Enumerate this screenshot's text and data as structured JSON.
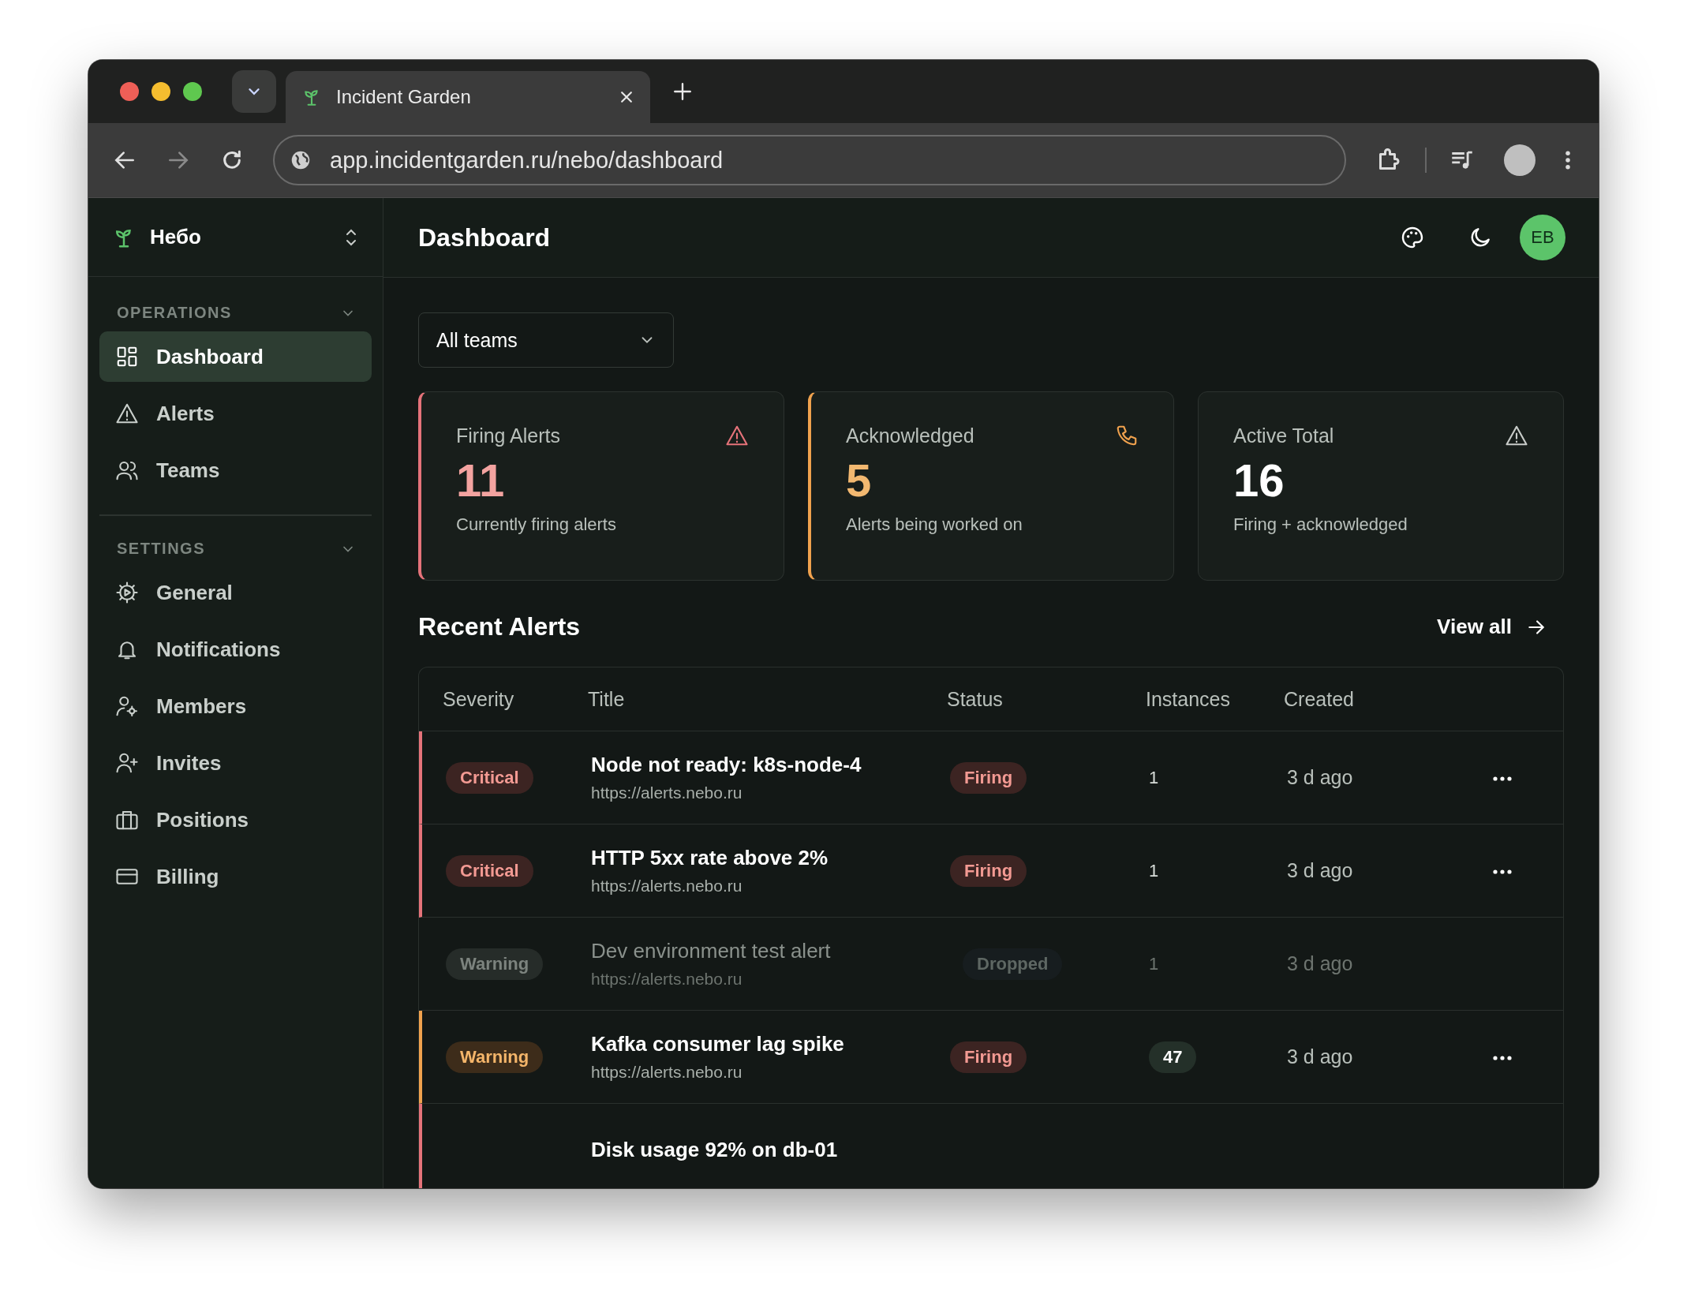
{
  "browser": {
    "tab_title": "Incident Garden",
    "url": "app.incidentgarden.ru/nebo/dashboard"
  },
  "sidebar": {
    "org": "Небо",
    "sections": [
      {
        "title": "OPERATIONS",
        "expanded": true,
        "items": [
          {
            "label": "Dashboard",
            "kind": "grid",
            "selected": true
          },
          {
            "label": "Alerts",
            "kind": "warning",
            "selected": false
          },
          {
            "label": "Teams",
            "kind": "users",
            "selected": false
          }
        ]
      },
      {
        "title": "SETTINGS",
        "expanded": true,
        "items": [
          {
            "label": "General",
            "kind": "gear",
            "selected": false
          },
          {
            "label": "Notifications",
            "kind": "bell",
            "selected": false
          },
          {
            "label": "Members",
            "kind": "user-gear",
            "selected": false
          },
          {
            "label": "Invites",
            "kind": "user-plus",
            "selected": false
          },
          {
            "label": "Positions",
            "kind": "briefcase",
            "selected": false
          },
          {
            "label": "Billing",
            "kind": "card",
            "selected": false
          }
        ]
      }
    ]
  },
  "header": {
    "title": "Dashboard",
    "avatar": "EB"
  },
  "filter": {
    "value": "All teams"
  },
  "cards": [
    {
      "title": "Firing Alerts",
      "value": "11",
      "caption": "Currently firing alerts",
      "kind": "firing"
    },
    {
      "title": "Acknowledged",
      "value": "5",
      "caption": "Alerts being worked on",
      "kind": "acknowledged"
    },
    {
      "title": "Active Total",
      "value": "16",
      "caption": "Firing + acknowledged",
      "kind": "total"
    }
  ],
  "recent": {
    "title": "Recent Alerts",
    "link": "View all",
    "columns": [
      "Severity",
      "Title",
      "Status",
      "Instances",
      "Created"
    ],
    "rows": [
      {
        "severity": {
          "label": "Critical",
          "kind": "critical"
        },
        "title": "Node not ready: k8s-node-4",
        "url": "https://alerts.nebo.ru",
        "status": {
          "label": "Firing",
          "kind": "firing"
        },
        "instances": "1",
        "instances_pill": false,
        "created": "3 d ago",
        "menu": true,
        "dimmed": false,
        "color": "#e5737a"
      },
      {
        "severity": {
          "label": "Critical",
          "kind": "critical"
        },
        "title": "HTTP 5xx rate above 2%",
        "url": "https://alerts.nebo.ru",
        "status": {
          "label": "Firing",
          "kind": "firing"
        },
        "instances": "1",
        "instances_pill": false,
        "created": "3 d ago",
        "menu": true,
        "dimmed": false,
        "color": "#e5737a"
      },
      {
        "severity": {
          "label": "Warning",
          "kind": "warning"
        },
        "title": "Dev environment test alert",
        "url": "https://alerts.nebo.ru",
        "status": {
          "label": "Dropped",
          "kind": "dropped"
        },
        "instances": "1",
        "instances_pill": false,
        "created": "3 d ago",
        "menu": false,
        "dimmed": true,
        "color": null
      },
      {
        "severity": {
          "label": "Warning",
          "kind": "warning"
        },
        "title": "Kafka consumer lag spike",
        "url": "https://alerts.nebo.ru",
        "status": {
          "label": "Firing",
          "kind": "firing"
        },
        "instances": "47",
        "instances_pill": true,
        "created": "3 d ago",
        "menu": true,
        "dimmed": false,
        "color": "#f0a24e"
      },
      {
        "title": "Disk usage 92% on db-01",
        "dimmed": false,
        "color": "#e5737a"
      }
    ]
  }
}
